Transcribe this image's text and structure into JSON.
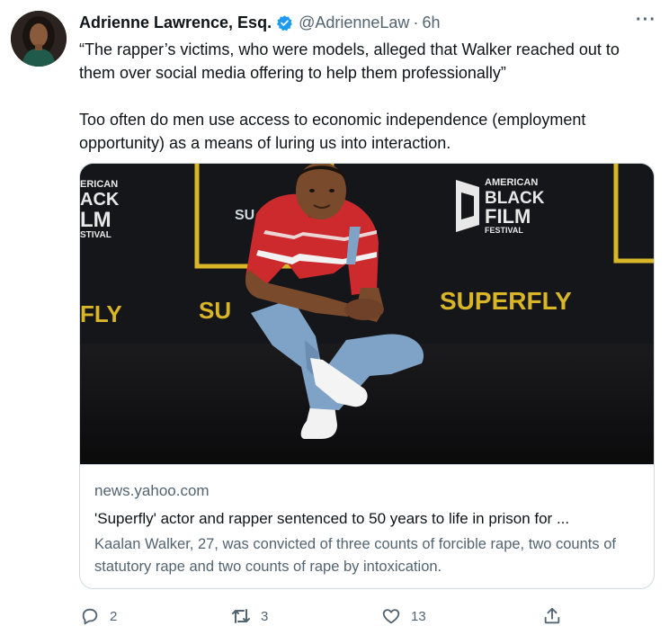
{
  "tweet": {
    "author_name": "Adrienne Lawrence, Esq.",
    "handle": "@AdrienneLaw",
    "separator": "·",
    "time": "6h",
    "more_label": "···",
    "text_paragraphs": [
      "“The rapper’s victims, who were models, alleged that Walker reached out to them over social media offering to help them professionally”",
      "Too often do men use access to economic independence (employment opportunity) as a means of luring us into interaction."
    ]
  },
  "card": {
    "image_text": {
      "left_banner_lines": [
        "ERICAN",
        "ACK",
        "LM",
        "STIVAL"
      ],
      "right_banner_lines": [
        "AMERICAN",
        "BLACK",
        "FILM",
        "FESTIVAL"
      ],
      "superfly": "SUPERFLY",
      "fly_left": "FLY",
      "su_mid": "SU",
      "su_top": "SU"
    },
    "domain": "news.yahoo.com",
    "title": "'Superfly' actor and rapper sentenced to 50 years to life in prison for ...",
    "description": "Kaalan Walker, 27, was convicted of three counts of forcible rape, two counts of statutory rape and two counts of rape by intoxication."
  },
  "actions": {
    "reply_count": "2",
    "retweet_count": "3",
    "like_count": "13"
  },
  "colors": {
    "text_primary": "#0f1419",
    "text_secondary": "#536471",
    "verified_blue": "#1d9bf0",
    "border": "#cfd9de",
    "backdrop_gold": "#d9b628"
  },
  "icons": [
    "verified-badge-icon",
    "more-icon",
    "reply-icon",
    "retweet-icon",
    "like-icon",
    "share-icon"
  ]
}
